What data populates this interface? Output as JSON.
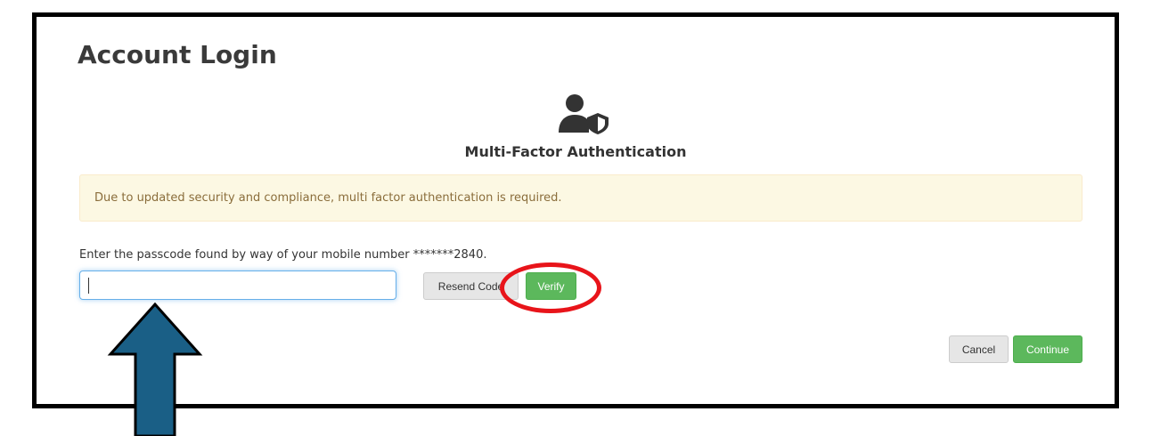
{
  "page": {
    "title": "Account Login"
  },
  "mfa": {
    "icon": "user-shield-icon",
    "title": "Multi-Factor Authentication"
  },
  "alert": {
    "message": "Due to updated security and compliance, multi factor authentication is required."
  },
  "form": {
    "prompt": "Enter the passcode found by way of your mobile number *******2840.",
    "passcode_value": "",
    "passcode_placeholder": ""
  },
  "buttons": {
    "resend_label": "Resend Code",
    "verify_label": "Verify",
    "cancel_label": "Cancel",
    "continue_label": "Continue"
  },
  "annotations": {
    "highlight_color": "#e8141a",
    "arrow_color": "#1a5f86"
  },
  "colors": {
    "success": "#5cb85c",
    "alert_bg": "#fcf8e3",
    "alert_text": "#8a6d3b",
    "focus_border": "#66afe9"
  }
}
